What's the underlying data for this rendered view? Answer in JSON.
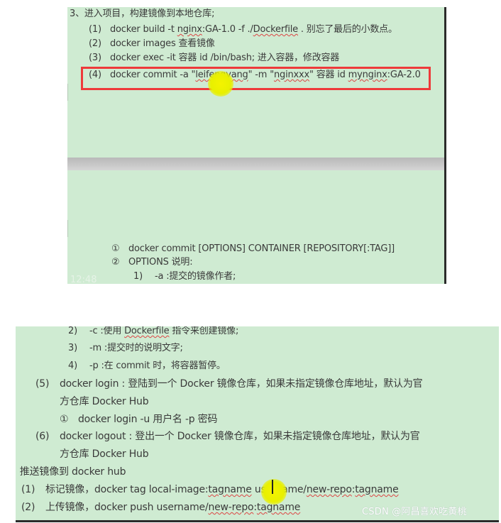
{
  "panel1": {
    "section_title": "3、进入项目，构建镜像到本地仓库;",
    "steps": [
      {
        "num": "(1)",
        "parts": [
          {
            "t": "docker build -t "
          },
          {
            "t": "nginx",
            "u": true
          },
          {
            "t": ":GA-1.0 -f ./"
          },
          {
            "t": "Dockerfile",
            "u": true
          },
          {
            "t": " .   别忘了最后的小数点。"
          }
        ]
      },
      {
        "num": "(2)",
        "parts": [
          {
            "t": "docker images  查看镜像"
          }
        ]
      },
      {
        "num": "(3)",
        "parts": [
          {
            "t": "docker exec -it  容器 id /bin/bash;  进入容器，修改容器"
          }
        ]
      },
      {
        "num": "(4)",
        "highlighted": true,
        "parts": [
          {
            "t": "docker commit -a \""
          },
          {
            "t": "leifengyang",
            "u": true
          },
          {
            "t": "\" -m \""
          },
          {
            "t": "nginxxx",
            "u": true
          },
          {
            "t": "\"  容器 id "
          },
          {
            "t": "mynginx",
            "u": true
          },
          {
            "t": ":GA-2.0"
          }
        ]
      }
    ],
    "syntax": [
      {
        "num": "①",
        "text": "docker commit [OPTIONS] CONTAINER [REPOSITORY[:TAG]]"
      },
      {
        "num": "②",
        "text": "OPTIONS 说明:"
      }
    ],
    "options_first": {
      "num": "1)",
      "text": "-a :提交的镜像作者;"
    },
    "timestamp": "12:48",
    "highlight_color": "#ee3a3a"
  },
  "panel2": {
    "options": [
      {
        "num": "2)",
        "parts": [
          {
            "t": "-c :使用 "
          },
          {
            "t": "Dockerfile",
            "u": true
          },
          {
            "t": " 指令来创建镜像;"
          }
        ]
      },
      {
        "num": "3)",
        "parts": [
          {
            "t": "-m :提交时的说明文字;"
          }
        ]
      },
      {
        "num": "4)",
        "parts": [
          {
            "t": "-p :在 commit 时，将容器暂停。"
          }
        ]
      }
    ],
    "login": {
      "num": "(5)",
      "line1": "docker login : 登陆到一个 Docker 镜像仓库，如果未指定镜像仓库地址，默认为官",
      "line2": "方仓库  Docker Hub",
      "sub_num": "①",
      "sub_text": "docker login -u  用户名  -p  密码"
    },
    "logout": {
      "num": "(6)",
      "line1": "docker logout : 登出一个 Docker 镜像仓库，如果未指定镜像仓库地址，默认为官",
      "line2": "方仓库  Docker Hub"
    },
    "push_title": "、推送镜像到 docker hub",
    "push_steps": [
      {
        "num": "(1)",
        "parts": [
          {
            "t": "标记镜像，docker tag local-image:"
          },
          {
            "t": "tagname",
            "u": true
          },
          {
            "t": " username/"
          },
          {
            "t": "new-repo",
            "u": true
          },
          {
            "t": ":"
          },
          {
            "t": "tagname",
            "u": true
          }
        ]
      },
      {
        "num": "(2)",
        "parts": [
          {
            "t": "上传镜像，docker push username/"
          },
          {
            "t": "new-repo",
            "u": true
          },
          {
            "t": ":"
          },
          {
            "t": "tagname",
            "u": true
          }
        ]
      }
    ],
    "watermark": "CSDN @阿昌喜欢吃黄桃"
  }
}
